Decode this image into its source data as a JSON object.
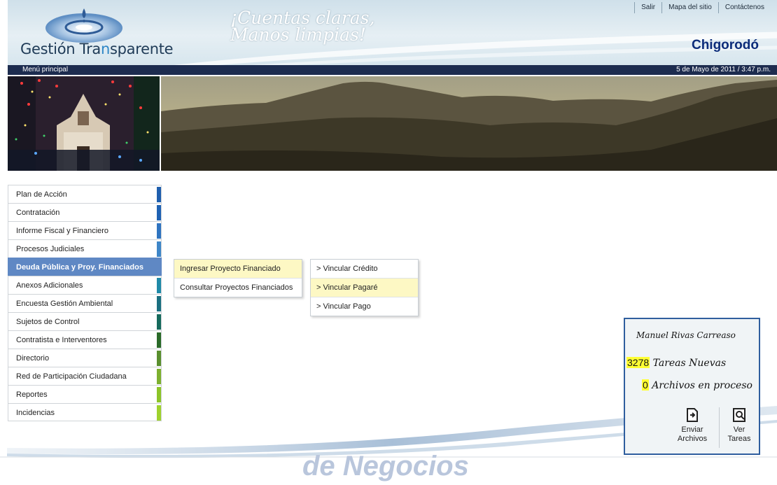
{
  "header": {
    "logo_main": "Gestión Tra",
    "logo_hl": "n",
    "logo_end": "sparente",
    "slogan_line1": "¡Cuentas claras,",
    "slogan_line2": "Manos limpias!",
    "top_links": [
      "Salir",
      "Mapa del sitio",
      "Contáctenos"
    ],
    "city": "Chigorodó"
  },
  "navbar": {
    "menu_label": "Menú principal",
    "datetime": "5 de Mayo de 2011 / 3:47 p.m."
  },
  "sidebar": {
    "items": [
      {
        "label": "Plan de Acción",
        "color": "#1f5fae"
      },
      {
        "label": "Contratación",
        "color": "#1f62b3"
      },
      {
        "label": "Informe Fiscal y Financiero",
        "color": "#2f74c0"
      },
      {
        "label": "Procesos Judiciales",
        "color": "#3e86c8"
      },
      {
        "label": "Deuda Pública y Proy. Financiados",
        "color": "#5f88c4",
        "active": true
      },
      {
        "label": "Anexos Adicionales",
        "color": "#1f8aa8"
      },
      {
        "label": "Encuesta Gestión Ambiental",
        "color": "#1a6f80"
      },
      {
        "label": "Sujetos de Control",
        "color": "#166a5c"
      },
      {
        "label": "Contratista e Interventores",
        "color": "#2a6a28"
      },
      {
        "label": "Directorio",
        "color": "#5a8f2e"
      },
      {
        "label": "Red de Participación Ciudadana",
        "color": "#7db02f"
      },
      {
        "label": "Reportes",
        "color": "#8cc428"
      },
      {
        "label": "Incidencias",
        "color": "#9fd22d"
      }
    ]
  },
  "submenu1": {
    "items": [
      "Ingresar Proyecto Financiado",
      "Consultar Proyectos Financiados"
    ]
  },
  "submenu2": {
    "items": [
      "> Vincular Crédito",
      "> Vincular Pagaré",
      "> Vincular Pago"
    ]
  },
  "footer": {
    "watermark": "de Negocios"
  },
  "user_panel": {
    "name": "Manuel Rivas Carreaso",
    "tasks_count": "3278",
    "tasks_label": "Tareas Nuevas",
    "files_count": "0",
    "files_label": "Archivos en proceso",
    "send_line1": "Enviar",
    "send_line2": "Archivos",
    "view_line1": "Ver",
    "view_line2": "Tareas",
    "send_icon": "send-files-icon",
    "view_icon": "view-tasks-icon"
  }
}
